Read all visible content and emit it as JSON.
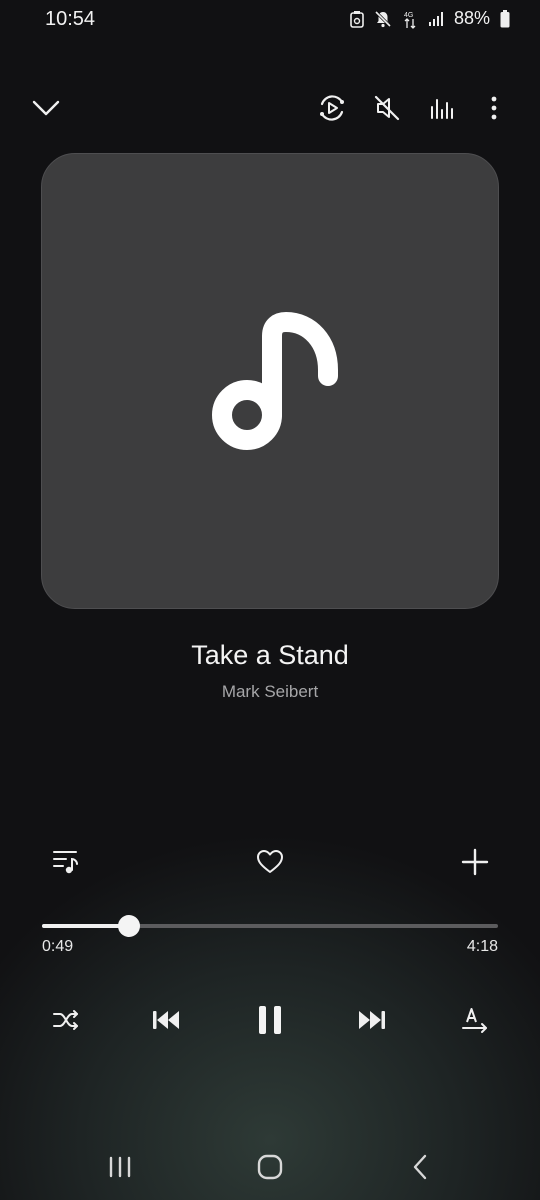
{
  "status_bar": {
    "time": "10:54",
    "battery_text": "88%",
    "icons": [
      "dnd-icon",
      "mute-icon",
      "data-arrows-icon",
      "signal-icon",
      "battery-icon"
    ]
  },
  "toolbar": {
    "icons": [
      "collapse-chevron-icon",
      "smart-view-icon",
      "volume-muted-icon",
      "equalizer-icon",
      "more-options-icon"
    ]
  },
  "now_playing": {
    "title": "Take a Stand",
    "artist": "Mark Seibert",
    "album_art_icon": "music-note-icon"
  },
  "actions": {
    "icons": [
      "playlist-icon",
      "favorite-heart-icon",
      "add-icon"
    ]
  },
  "progress": {
    "elapsed": "0:49",
    "duration": "4:18",
    "fraction": 0.19
  },
  "controls": {
    "icons": [
      "shuffle-icon",
      "previous-icon",
      "pause-icon",
      "next-icon",
      "repeat-a-icon"
    ]
  },
  "nav_bar": {
    "icons": [
      "recents-icon",
      "home-icon",
      "back-icon"
    ]
  },
  "colors": {
    "accent": "#f0f0f0",
    "album_bg": "#3d3d3e",
    "track_bg": "#5c5c5e"
  }
}
